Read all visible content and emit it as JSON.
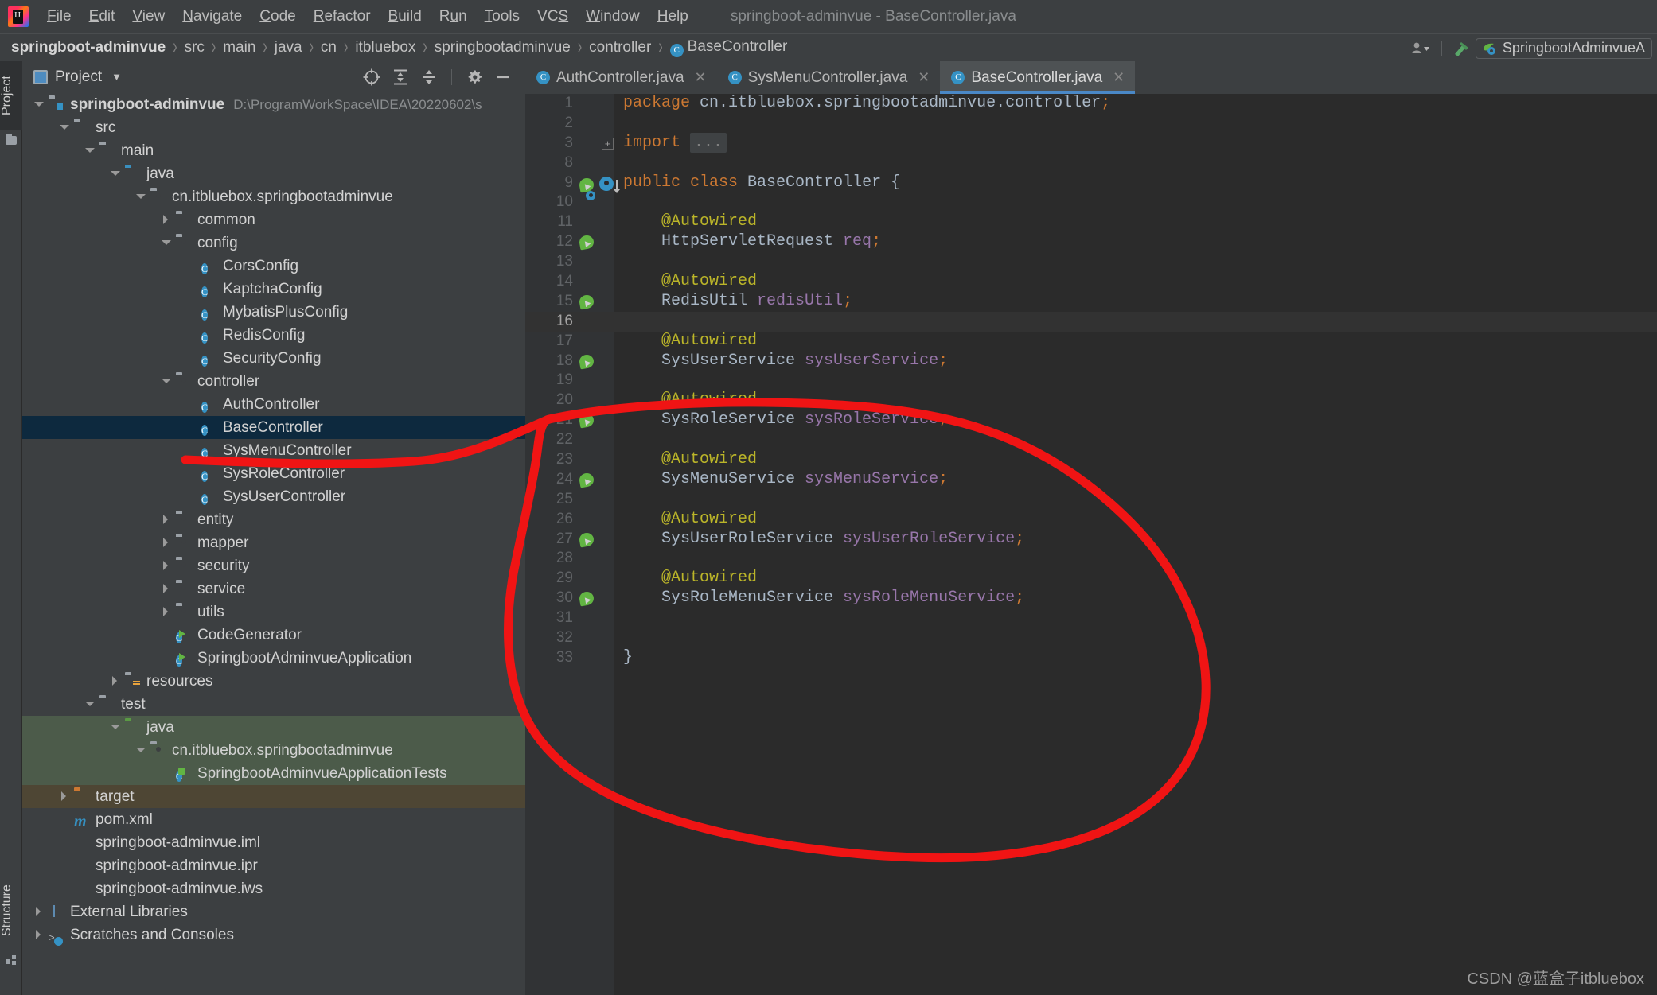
{
  "window": {
    "title": "springboot-adminvue - BaseController.java"
  },
  "menubar": {
    "items": [
      {
        "label": "File",
        "mnemonic": "F"
      },
      {
        "label": "Edit",
        "mnemonic": "E"
      },
      {
        "label": "View",
        "mnemonic": "V"
      },
      {
        "label": "Navigate",
        "mnemonic": "N"
      },
      {
        "label": "Code",
        "mnemonic": "C"
      },
      {
        "label": "Refactor",
        "mnemonic": "R"
      },
      {
        "label": "Build",
        "mnemonic": "B"
      },
      {
        "label": "Run",
        "mnemonic": "u"
      },
      {
        "label": "Tools",
        "mnemonic": "T"
      },
      {
        "label": "VCS",
        "mnemonic": "S"
      },
      {
        "label": "Window",
        "mnemonic": "W"
      },
      {
        "label": "Help",
        "mnemonic": "H"
      }
    ]
  },
  "navbar": {
    "breadcrumbs": [
      "springboot-adminvue",
      "src",
      "main",
      "java",
      "cn",
      "itbluebox",
      "springbootadminvue",
      "controller"
    ],
    "current_file": "BaseController",
    "current_file_badge": "C",
    "separator": "›",
    "run_config": "SpringbootAdminvueA",
    "icons": [
      "user-dropdown-icon",
      "build-hammer-icon",
      "spring-boot-icon"
    ]
  },
  "toolstrip": {
    "top": {
      "label": "Project",
      "icon": "folder-icon"
    },
    "bottom": {
      "label": "Structure",
      "icon": "structure-icon"
    }
  },
  "project_panel": {
    "title": "Project",
    "toolbar_icons": [
      "locate-icon",
      "expand-all-icon",
      "collapse-all-icon",
      "gear-icon",
      "hide-icon"
    ],
    "tree": [
      {
        "depth": 0,
        "arrow": "down",
        "icon": "module-root",
        "label": "springboot-adminvue",
        "bold": true,
        "note": "D:\\ProgramWorkSpace\\IDEA\\20220602\\s",
        "state": "normal"
      },
      {
        "depth": 1,
        "arrow": "down",
        "icon": "folder",
        "label": "src",
        "state": "normal"
      },
      {
        "depth": 2,
        "arrow": "down",
        "icon": "folder",
        "label": "main",
        "state": "normal"
      },
      {
        "depth": 3,
        "arrow": "down",
        "icon": "folder-blue",
        "label": "java",
        "state": "normal"
      },
      {
        "depth": 4,
        "arrow": "down",
        "icon": "package",
        "label": "cn.itbluebox.springbootadminvue",
        "state": "normal"
      },
      {
        "depth": 5,
        "arrow": "right",
        "icon": "package",
        "label": "common",
        "state": "normal"
      },
      {
        "depth": 5,
        "arrow": "down",
        "icon": "package",
        "label": "config",
        "state": "normal"
      },
      {
        "depth": 6,
        "arrow": "none",
        "icon": "class",
        "label": "CorsConfig",
        "state": "normal"
      },
      {
        "depth": 6,
        "arrow": "none",
        "icon": "class",
        "label": "KaptchaConfig",
        "state": "normal"
      },
      {
        "depth": 6,
        "arrow": "none",
        "icon": "class",
        "label": "MybatisPlusConfig",
        "state": "normal"
      },
      {
        "depth": 6,
        "arrow": "none",
        "icon": "class",
        "label": "RedisConfig",
        "state": "normal"
      },
      {
        "depth": 6,
        "arrow": "none",
        "icon": "class",
        "label": "SecurityConfig",
        "state": "normal"
      },
      {
        "depth": 5,
        "arrow": "down",
        "icon": "package",
        "label": "controller",
        "state": "normal"
      },
      {
        "depth": 6,
        "arrow": "none",
        "icon": "class",
        "label": "AuthController",
        "state": "normal"
      },
      {
        "depth": 6,
        "arrow": "none",
        "icon": "class",
        "label": "BaseController",
        "state": "selected"
      },
      {
        "depth": 6,
        "arrow": "none",
        "icon": "class",
        "label": "SysMenuController",
        "state": "normal"
      },
      {
        "depth": 6,
        "arrow": "none",
        "icon": "class",
        "label": "SysRoleController",
        "state": "normal"
      },
      {
        "depth": 6,
        "arrow": "none",
        "icon": "class",
        "label": "SysUserController",
        "state": "normal"
      },
      {
        "depth": 5,
        "arrow": "right",
        "icon": "package",
        "label": "entity",
        "state": "normal"
      },
      {
        "depth": 5,
        "arrow": "right",
        "icon": "package",
        "label": "mapper",
        "state": "normal"
      },
      {
        "depth": 5,
        "arrow": "right",
        "icon": "package",
        "label": "security",
        "state": "normal"
      },
      {
        "depth": 5,
        "arrow": "right",
        "icon": "package",
        "label": "service",
        "state": "normal"
      },
      {
        "depth": 5,
        "arrow": "right",
        "icon": "package",
        "label": "utils",
        "state": "normal"
      },
      {
        "depth": 5,
        "arrow": "none",
        "icon": "class-run",
        "label": "CodeGenerator",
        "state": "normal"
      },
      {
        "depth": 5,
        "arrow": "none",
        "icon": "class-spring",
        "label": "SpringbootAdminvueApplication",
        "state": "normal"
      },
      {
        "depth": 3,
        "arrow": "right",
        "icon": "resources",
        "label": "resources",
        "state": "normal"
      },
      {
        "depth": 2,
        "arrow": "down",
        "icon": "folder",
        "label": "test",
        "state": "normal"
      },
      {
        "depth": 3,
        "arrow": "down",
        "icon": "folder-green",
        "label": "java",
        "state": "green"
      },
      {
        "depth": 4,
        "arrow": "down",
        "icon": "package",
        "label": "cn.itbluebox.springbootadminvue",
        "state": "green"
      },
      {
        "depth": 5,
        "arrow": "none",
        "icon": "class-test",
        "label": "SpringbootAdminvueApplicationTests",
        "state": "green"
      },
      {
        "depth": 1,
        "arrow": "right",
        "icon": "folder-orange",
        "label": "target",
        "state": "brown"
      },
      {
        "depth": 1,
        "arrow": "none",
        "icon": "maven",
        "label": "pom.xml",
        "state": "normal"
      },
      {
        "depth": 1,
        "arrow": "none",
        "icon": "file",
        "label": "springboot-adminvue.iml",
        "state": "normal"
      },
      {
        "depth": 1,
        "arrow": "none",
        "icon": "file",
        "label": "springboot-adminvue.ipr",
        "state": "normal"
      },
      {
        "depth": 1,
        "arrow": "none",
        "icon": "file",
        "label": "springboot-adminvue.iws",
        "state": "normal"
      },
      {
        "depth": 0,
        "arrow": "right",
        "icon": "library",
        "label": "External Libraries",
        "state": "normal"
      },
      {
        "depth": 0,
        "arrow": "right",
        "icon": "scratch",
        "label": "Scratches and Consoles",
        "state": "normal"
      }
    ]
  },
  "editor": {
    "tabs": [
      {
        "label": "AuthController.java",
        "badge": "C",
        "active": false,
        "close": "✕"
      },
      {
        "label": "SysMenuController.java",
        "badge": "C",
        "active": false,
        "close": "✕"
      },
      {
        "label": "BaseController.java",
        "badge": "C",
        "active": true,
        "close": "✕"
      }
    ],
    "lines": [
      {
        "num": "1",
        "gutter": "",
        "current": false,
        "tokens": [
          {
            "t": "package",
            "c": "kw"
          },
          {
            "t": " cn.itbluebox.springbootadminvue.controller",
            "c": "pkgn"
          },
          {
            "t": ";",
            "c": "punc"
          }
        ]
      },
      {
        "num": "2",
        "gutter": "",
        "current": false,
        "tokens": []
      },
      {
        "num": "3",
        "gutter": "",
        "current": false,
        "fold": "+",
        "tokens": [
          {
            "t": "import",
            "c": "kw"
          },
          {
            "t": " ",
            "c": "id"
          },
          {
            "t": "...",
            "c": "folded"
          }
        ]
      },
      {
        "num": "8",
        "gutter": "",
        "current": false,
        "tokens": []
      },
      {
        "num": "9",
        "gutter": "bean-spring-override",
        "current": false,
        "tokens": [
          {
            "t": "public",
            "c": "kw"
          },
          {
            "t": " ",
            "c": "id"
          },
          {
            "t": "class",
            "c": "kw"
          },
          {
            "t": " BaseController {",
            "c": "id"
          }
        ]
      },
      {
        "num": "10",
        "gutter": "",
        "current": false,
        "tokens": []
      },
      {
        "num": "11",
        "gutter": "",
        "current": false,
        "tokens": [
          {
            "t": "    @Autowired",
            "c": "ann"
          }
        ]
      },
      {
        "num": "12",
        "gutter": "bean",
        "current": false,
        "tokens": [
          {
            "t": "    HttpServletRequest ",
            "c": "id"
          },
          {
            "t": "req",
            "c": "fld"
          },
          {
            "t": ";",
            "c": "punc"
          }
        ]
      },
      {
        "num": "13",
        "gutter": "",
        "current": false,
        "tokens": []
      },
      {
        "num": "14",
        "gutter": "",
        "current": false,
        "tokens": [
          {
            "t": "    @Autowired",
            "c": "ann"
          }
        ]
      },
      {
        "num": "15",
        "gutter": "bean",
        "current": false,
        "tokens": [
          {
            "t": "    RedisUtil ",
            "c": "id"
          },
          {
            "t": "redisUtil",
            "c": "fld"
          },
          {
            "t": ";",
            "c": "punc"
          }
        ]
      },
      {
        "num": "16",
        "gutter": "",
        "current": true,
        "tokens": []
      },
      {
        "num": "17",
        "gutter": "",
        "current": false,
        "tokens": [
          {
            "t": "    @Autowired",
            "c": "ann"
          }
        ]
      },
      {
        "num": "18",
        "gutter": "bean",
        "current": false,
        "tokens": [
          {
            "t": "    SysUserService ",
            "c": "id"
          },
          {
            "t": "sysUserService",
            "c": "fld"
          },
          {
            "t": ";",
            "c": "punc"
          }
        ]
      },
      {
        "num": "19",
        "gutter": "",
        "current": false,
        "tokens": []
      },
      {
        "num": "20",
        "gutter": "",
        "current": false,
        "tokens": [
          {
            "t": "    @Autowired",
            "c": "ann"
          }
        ]
      },
      {
        "num": "21",
        "gutter": "bean",
        "current": false,
        "tokens": [
          {
            "t": "    SysRoleService ",
            "c": "id"
          },
          {
            "t": "sysRoleService",
            "c": "fld"
          },
          {
            "t": ";",
            "c": "punc"
          }
        ]
      },
      {
        "num": "22",
        "gutter": "",
        "current": false,
        "tokens": []
      },
      {
        "num": "23",
        "gutter": "",
        "current": false,
        "tokens": [
          {
            "t": "    @Autowired",
            "c": "ann"
          }
        ]
      },
      {
        "num": "24",
        "gutter": "bean",
        "current": false,
        "tokens": [
          {
            "t": "    SysMenuService ",
            "c": "id"
          },
          {
            "t": "sysMenuService",
            "c": "fld"
          },
          {
            "t": ";",
            "c": "punc"
          }
        ]
      },
      {
        "num": "25",
        "gutter": "",
        "current": false,
        "tokens": []
      },
      {
        "num": "26",
        "gutter": "",
        "current": false,
        "tokens": [
          {
            "t": "    @Autowired",
            "c": "ann"
          }
        ]
      },
      {
        "num": "27",
        "gutter": "bean",
        "current": false,
        "tokens": [
          {
            "t": "    SysUserRoleService ",
            "c": "id"
          },
          {
            "t": "sysUserRoleService",
            "c": "fld"
          },
          {
            "t": ";",
            "c": "punc"
          }
        ]
      },
      {
        "num": "28",
        "gutter": "",
        "current": false,
        "tokens": []
      },
      {
        "num": "29",
        "gutter": "",
        "current": false,
        "tokens": [
          {
            "t": "    @Autowired",
            "c": "ann"
          }
        ]
      },
      {
        "num": "30",
        "gutter": "bean",
        "current": false,
        "tokens": [
          {
            "t": "    SysRoleMenuService ",
            "c": "id"
          },
          {
            "t": "sysRoleMenuService",
            "c": "fld"
          },
          {
            "t": ";",
            "c": "punc"
          }
        ]
      },
      {
        "num": "31",
        "gutter": "",
        "current": false,
        "tokens": []
      },
      {
        "num": "32",
        "gutter": "",
        "current": false,
        "tokens": []
      },
      {
        "num": "33",
        "gutter": "",
        "current": false,
        "tokens": [
          {
            "t": "}",
            "c": "id"
          }
        ]
      }
    ]
  },
  "annotation": {
    "color": "#f01414",
    "shape": "hand-drawn-red-ellipse-around-autowired-services"
  },
  "watermark": {
    "text": "CSDN @蓝盒子itbluebox"
  },
  "colors": {
    "chrome": "#3c3f41",
    "editor_bg": "#2b2b2b",
    "gutter_bg": "#313335",
    "selection": "#0d293e",
    "accent_blue": "#3592c4",
    "annotation_red": "#f01414",
    "keyword_orange": "#cc7832",
    "annotation_yellow": "#bbb529",
    "field_purple": "#9876aa",
    "text_grey": "#a9b7c6"
  }
}
